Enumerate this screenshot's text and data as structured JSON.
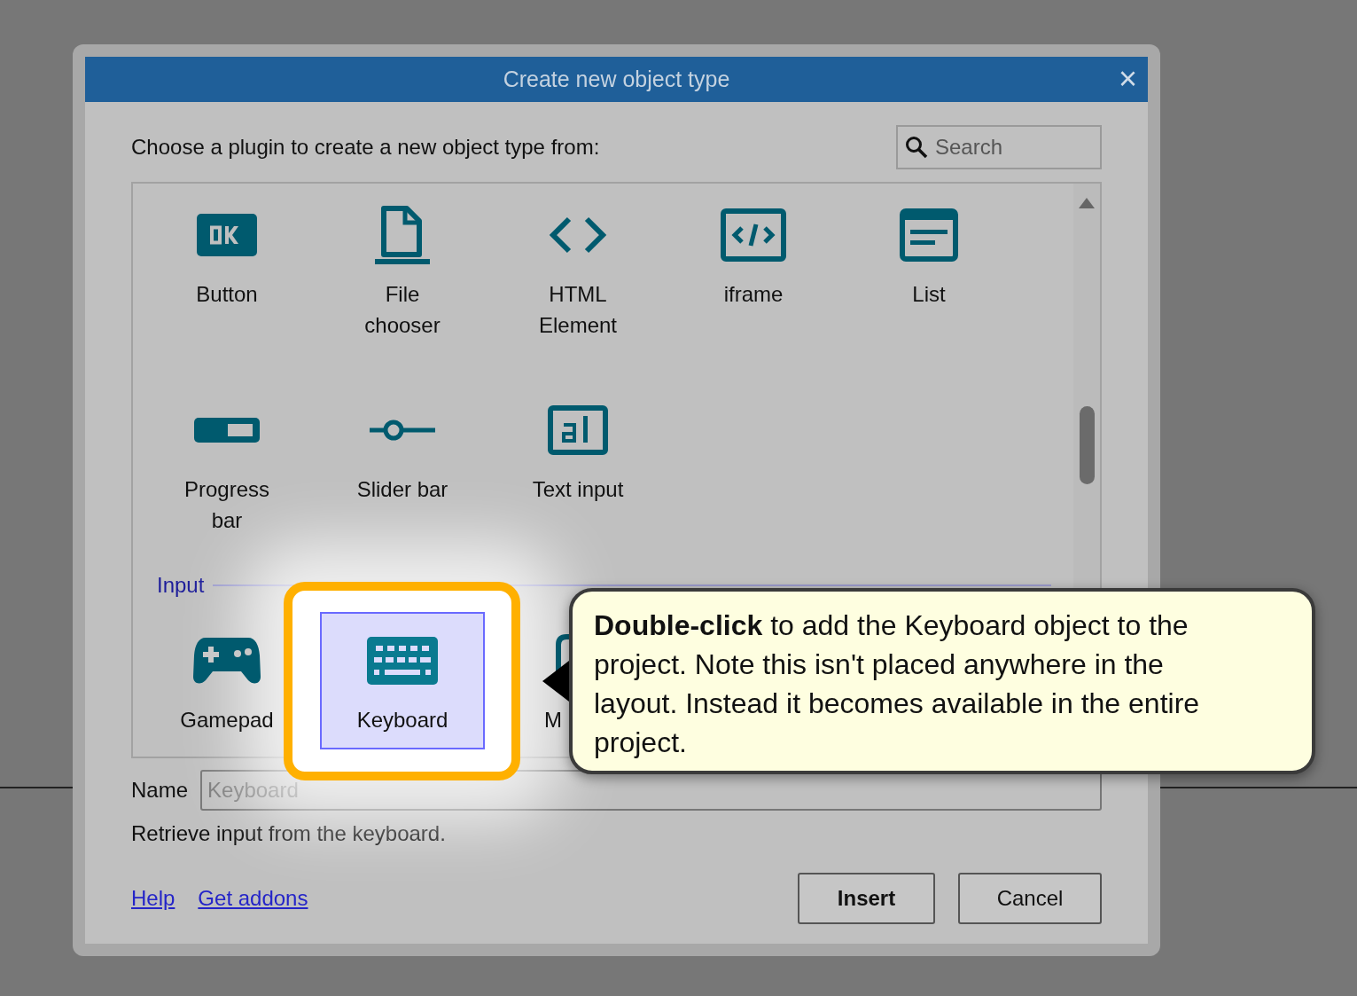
{
  "dialog": {
    "title": "Create new object type",
    "close": "×",
    "prompt": "Choose a plugin to create a new object type from:",
    "search": {
      "placeholder": "Search"
    },
    "sections": [
      {
        "items": [
          {
            "label": "Button",
            "selected": false,
            "cut": false
          },
          {
            "label": "File chooser",
            "selected": false,
            "cut": false
          },
          {
            "label": "HTML Element",
            "selected": false,
            "cut": false
          },
          {
            "label": "iframe",
            "selected": false,
            "cut": false
          },
          {
            "label": "List",
            "selected": false,
            "cut": false
          },
          {
            "label": "Progress bar",
            "selected": false,
            "cut": false
          },
          {
            "label": "Slider bar",
            "selected": false,
            "cut": false
          },
          {
            "label": "Text input",
            "selected": false,
            "cut": false
          }
        ]
      },
      {
        "header": "Input",
        "items": [
          {
            "label": "Gamepad",
            "selected": false,
            "cut": false
          },
          {
            "label": "Keyboard",
            "selected": true,
            "cut": false
          },
          {
            "label": "M",
            "selected": false,
            "cut": true
          }
        ]
      }
    ],
    "name_label": "Name",
    "name_field": {
      "placeholder": "Keyboard"
    },
    "description": "Retrieve input from the keyboard.",
    "links": [
      "Help",
      "Get addons"
    ],
    "buttons": [
      {
        "label": "Insert",
        "default": true
      },
      {
        "label": "Cancel",
        "default": false
      }
    ]
  },
  "tooltip": {
    "text": "**Double-click** to add the Keyboard object to the project. Note this isn't placed anywhere in the layout. Instead it becomes available in the entire project."
  }
}
